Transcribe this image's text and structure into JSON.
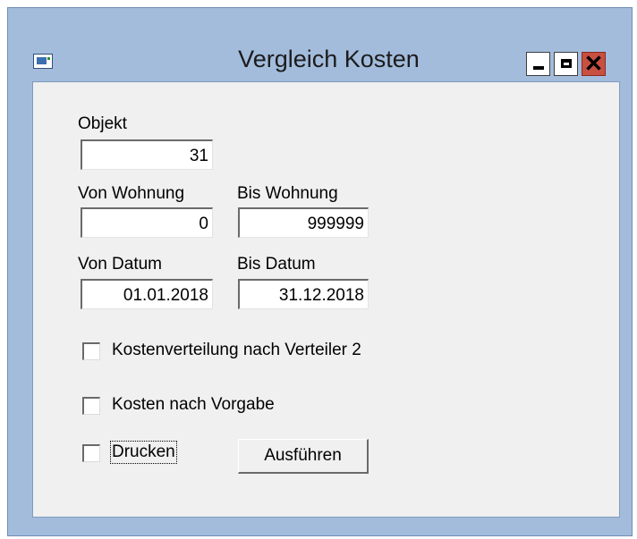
{
  "window": {
    "title": "Vergleich Kosten"
  },
  "form": {
    "objekt_label": "Objekt",
    "objekt_value": "31",
    "von_wohnung_label": "Von Wohnung",
    "von_wohnung_value": "0",
    "bis_wohnung_label": "Bis Wohnung",
    "bis_wohnung_value": "999999",
    "von_datum_label": "Von Datum",
    "von_datum_value": "01.01.2018",
    "bis_datum_label": "Bis Datum",
    "bis_datum_value": "31.12.2018"
  },
  "options": {
    "verteiler_label": "Kostenverteilung nach Verteiler 2",
    "vorgabe_label": "Kosten nach Vorgabe",
    "drucken_label": "Drucken"
  },
  "actions": {
    "ausfuehren_label": "Ausführen"
  }
}
